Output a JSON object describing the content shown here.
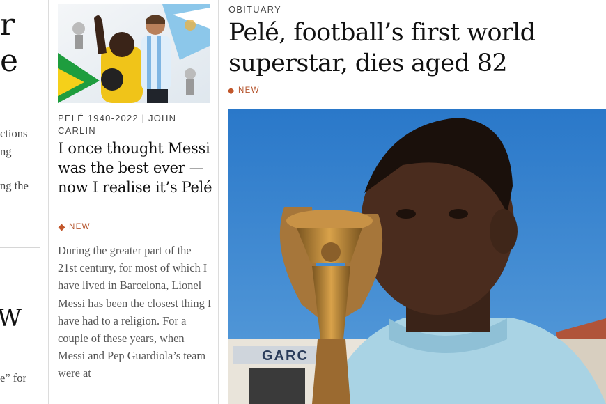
{
  "left_column": {
    "headline_fragment_1": "r",
    "headline_fragment_2": "e",
    "text_lines": [
      "ctions",
      "ng",
      "ng the"
    ],
    "headline_fragment_3": "W",
    "bottom_text": "e” for"
  },
  "middle_article": {
    "image_alt": "Pelé and Messi collage",
    "kicker": "PELÉ 1940-2022 | JOHN CARLIN",
    "headline": "I once thought Messi was the best ever — now I realise it’s Pelé",
    "new_label": "NEW",
    "excerpt": "During the greater part of the 21st century, for most of which I have lived in Barcelona, Lionel Messi has been the closest thing I have had to a religion. For a couple of these years, when Messi and Pep Guardiola’s team were at"
  },
  "main_article": {
    "kicker": "OBITUARY",
    "headline": "Pelé, football’s first world superstar, dies aged 82",
    "new_label": "NEW",
    "image_alt": "Pelé kissing the Jules Rimet trophy",
    "sign_text": "GARC"
  },
  "colors": {
    "accent": "#c2572b",
    "sky": "#2f7fcd"
  }
}
